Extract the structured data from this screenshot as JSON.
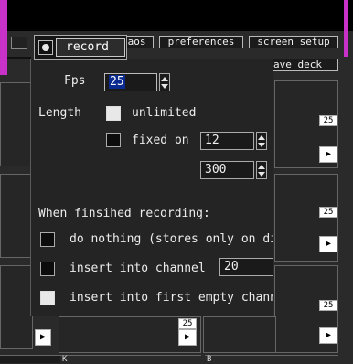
{
  "menu": {
    "chaos": "chaos",
    "preferences": "preferences",
    "screen_setup": "screen setup",
    "save_deck_partial": "ave deck"
  },
  "dialog": {
    "record_tab": "record",
    "fps_label": "Fps",
    "fps_value": "25",
    "length_label": "Length",
    "unlimited_label": "unlimited",
    "fixed_on_label": "fixed on",
    "fixed_on_value": "12",
    "frames_value": "300",
    "when_finished_label": "When finsihed recording:",
    "opt_do_nothing": "do nothing (stores only on di",
    "opt_insert_channel": "insert into channel",
    "insert_channel_value": "20",
    "opt_insert_first_empty": "insert into first empty channe"
  },
  "background": {
    "chip_values": [
      "25",
      "25",
      "25",
      "25"
    ],
    "play_glyph": "▶",
    "bottom_label_1": "K",
    "bottom_label_2": "B"
  }
}
